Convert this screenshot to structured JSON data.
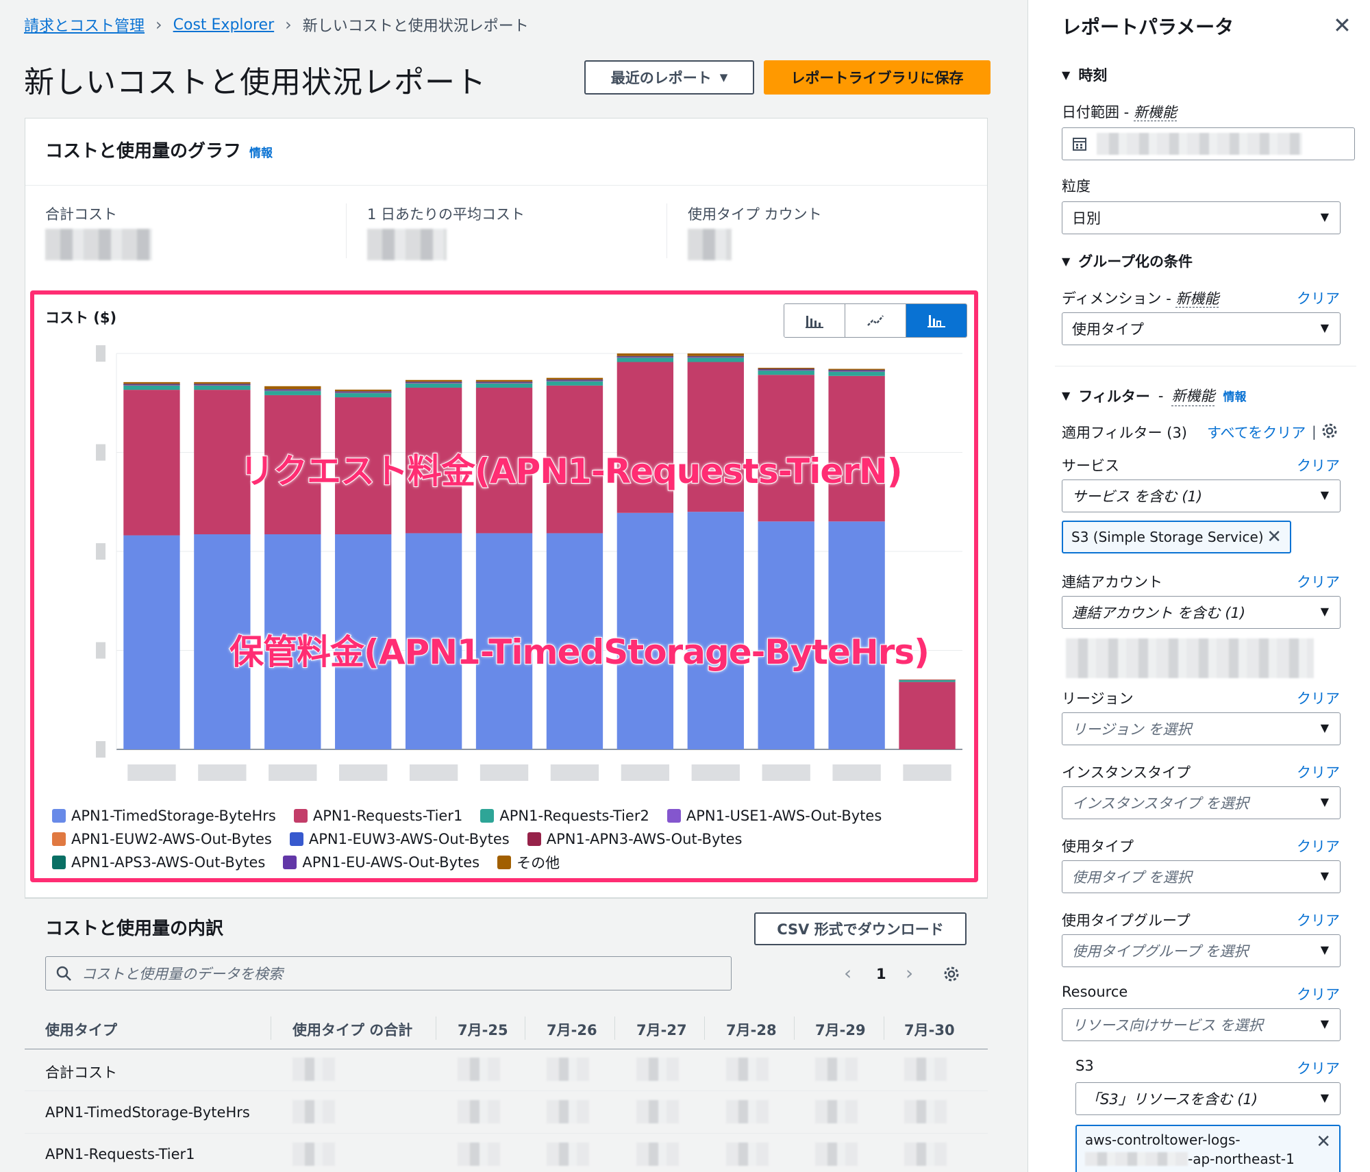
{
  "breadcrumb": {
    "items": [
      "請求とコスト管理",
      "Cost Explorer"
    ],
    "current": "新しいコストと使用状況レポート"
  },
  "page": {
    "title": "新しいコストと使用状況レポート"
  },
  "header_buttons": {
    "recent": "最近のレポート",
    "save": "レポートライブラリに保存"
  },
  "graph_section": {
    "title": "コストと使用量のグラフ",
    "info": "情報",
    "kpis": [
      "合計コスト",
      "1 日あたりの平均コスト",
      "使用タイプ カウント"
    ]
  },
  "chart_data": {
    "type": "bar",
    "stacked": true,
    "ylabel": "コスト ($)",
    "categories": [
      "",
      "",
      "",
      "",
      "",
      "",
      "",
      "",
      "",
      "",
      "",
      ""
    ],
    "series": [
      {
        "name": "APN1-TimedStorage-ByteHrs",
        "color": "#688ae8",
        "values": [
          100,
          100.5,
          100.5,
          100.5,
          101,
          101,
          101,
          110.5,
          111,
          106.5,
          106.5,
          0
        ]
      },
      {
        "name": "APN1-Requests-Tier1",
        "color": "#c33d69",
        "values": [
          68,
          67.5,
          65,
          64,
          68,
          68,
          69,
          70.5,
          70,
          68.5,
          68,
          31.5
        ]
      },
      {
        "name": "APN1-Requests-Tier2",
        "color": "#2ea597",
        "values": [
          2,
          2,
          2,
          2,
          2,
          2,
          2,
          2,
          2,
          2,
          2,
          1
        ]
      },
      {
        "name": "APN1-USE1-AWS-Out-Bytes",
        "color": "#8456ce",
        "values": [
          0.2,
          0.2,
          0.2,
          0.2,
          0.2,
          0.2,
          0.2,
          0.2,
          0.2,
          0.2,
          0.2,
          0.1
        ]
      },
      {
        "name": "APN1-EUW2-AWS-Out-Bytes",
        "color": "#e07941",
        "values": [
          0.2,
          0.2,
          0.2,
          0.2,
          0.2,
          0.2,
          0.2,
          0.2,
          0.2,
          0.2,
          0.2,
          0.1
        ]
      },
      {
        "name": "APN1-EUW3-AWS-Out-Bytes",
        "color": "#3759ce",
        "values": [
          0.1,
          0.1,
          0.1,
          0.1,
          0.1,
          0.1,
          0.1,
          0.1,
          0.1,
          0.1,
          0.1,
          0
        ]
      },
      {
        "name": "APN1-APN3-AWS-Out-Bytes",
        "color": "#962249",
        "values": [
          0.1,
          0.1,
          0.1,
          0.1,
          0.1,
          0.1,
          0.1,
          0.1,
          0.1,
          0.1,
          0.1,
          0
        ]
      },
      {
        "name": "APN1-APS3-AWS-Out-Bytes",
        "color": "#096f64",
        "values": [
          0.1,
          0.1,
          0.1,
          0.1,
          0.1,
          0.1,
          0.1,
          0.1,
          0.1,
          0.1,
          0.1,
          0
        ]
      },
      {
        "name": "APN1-EU-AWS-Out-Bytes",
        "color": "#6237a7",
        "values": [
          0.1,
          0.1,
          0.1,
          0.1,
          0.1,
          0.1,
          0.1,
          0.1,
          0.1,
          0.1,
          0.1,
          0
        ]
      },
      {
        "name": "その他",
        "color": "#a15f00",
        "values": [
          0.8,
          0.8,
          1.4,
          0.8,
          0.8,
          0.8,
          0.8,
          1.2,
          1.2,
          0.5,
          0.5,
          0
        ]
      }
    ],
    "ylim": [
      0,
      185
    ],
    "grid": true,
    "legend": "bottom",
    "annotations": [
      "リクエスト料金(APN1-Requests-TierN)",
      "保管料金(APN1-TimedStorage-ByteHrs)"
    ]
  },
  "breakdown": {
    "title": "コストと使用量の内訳",
    "csv_button": "CSV 形式でダウンロード",
    "search_placeholder": "コストと使用量のデータを検索",
    "page_number": "1",
    "columns": [
      "使用タイプ",
      "使用タイプ の合計",
      "7月-25",
      "7月-26",
      "7月-27",
      "7月-28",
      "7月-29",
      "7月-30"
    ],
    "rows": [
      "合計コスト",
      "APN1-TimedStorage-ByteHrs",
      "APN1-Requests-Tier1"
    ]
  },
  "params": {
    "title": "レポートパラメータ",
    "time_section": "時刻",
    "date_range_label": "日付範囲",
    "new_feature": "新機能",
    "granularity_label": "粒度",
    "granularity_value": "日別",
    "group_section": "グループ化の条件",
    "dimension_label": "ディメンション",
    "dimension_value": "使用タイプ",
    "clear": "クリア",
    "filter_section": "フィルター",
    "info": "情報",
    "applied_filters": "適用フィルター (3)",
    "clear_all": "すべてをクリア",
    "service_label": "サービス",
    "service_value": "サービス を含む (1)",
    "service_token": "S3 (Simple Storage Service)",
    "linked_account_label": "連結アカウント",
    "linked_account_value": "連結アカウント を含む (1)",
    "region_label": "リージョン",
    "region_placeholder": "リージョン を選択",
    "instance_type_label": "インスタンスタイプ",
    "instance_type_placeholder": "インスタンスタイプ を選択",
    "usage_type_label": "使用タイプ",
    "usage_type_placeholder": "使用タイプ を選択",
    "usage_type_group_label": "使用タイプグループ",
    "usage_type_group_placeholder": "使用タイプグループ を選択",
    "resource_label": "Resource",
    "resource_placeholder": "リソース向けサービス を選択",
    "s3_label": "S3",
    "s3_value": "「S3」リソースを含む (1)",
    "resource_token_line1": "aws-controltower-logs-",
    "resource_token_line2": "-ap-northeast-1"
  }
}
